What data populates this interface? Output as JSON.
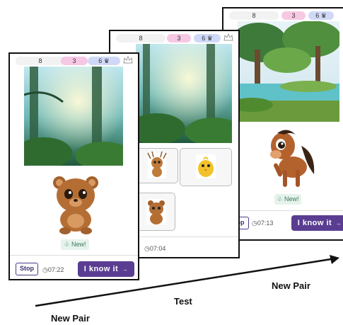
{
  "screens": {
    "first": {
      "hud": {
        "count": "8",
        "pink": "3",
        "blue": "6"
      },
      "badge": "New!",
      "stop_label": "Stop",
      "timer": "07:22",
      "know_label": "I know it",
      "know_arrow": "→"
    },
    "test": {
      "hud": {
        "count": "8",
        "pink": "3",
        "blue": "6"
      },
      "timer": "07:04"
    },
    "third": {
      "hud": {
        "count": "8",
        "pink": "3",
        "blue": "6"
      },
      "badge": "New!",
      "stop_label": "op",
      "timer": "07:13",
      "know_label": "I know it",
      "know_arrow": "→"
    }
  },
  "captions": {
    "new_pair_left": "New Pair",
    "test": "Test",
    "new_pair_right": "New Pair"
  },
  "icons": {
    "crown": "crown-icon",
    "clock": "clock-icon",
    "badge": "sprout-icon"
  },
  "colors": {
    "accent": "#5a3d91",
    "pink_pill": "#f6c8e4",
    "blue_pill": "#cfd9f7"
  }
}
